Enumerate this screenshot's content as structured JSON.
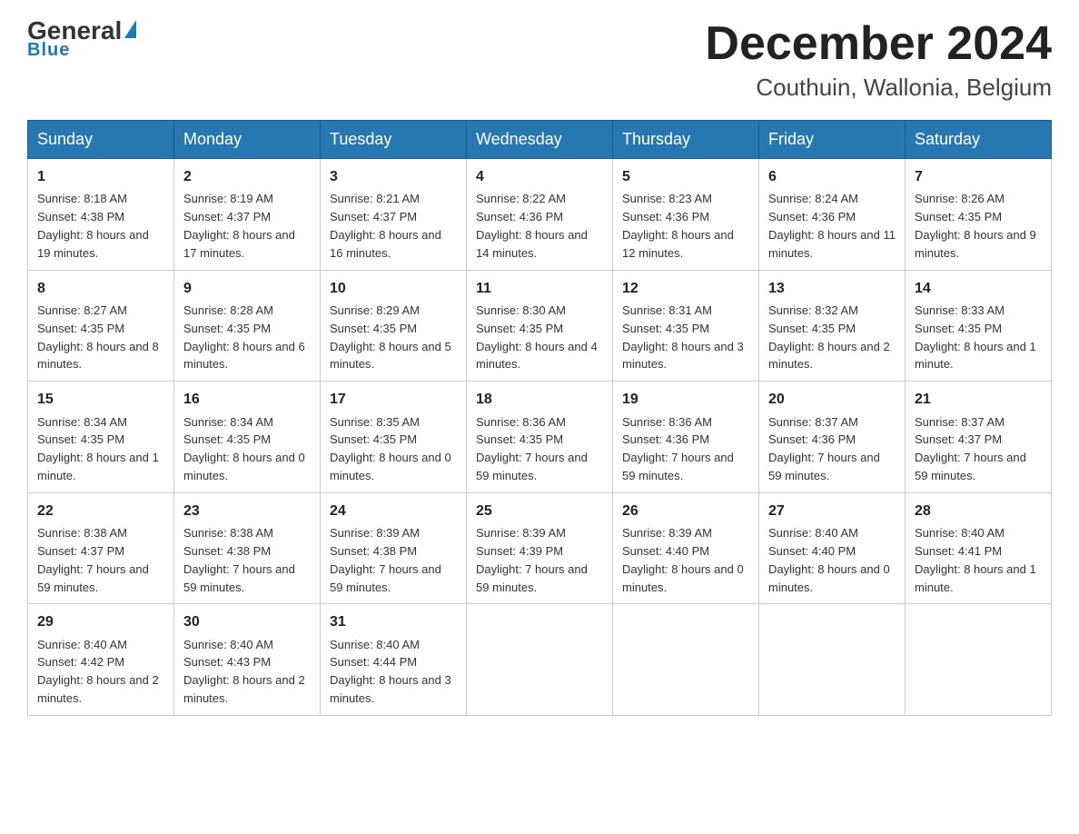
{
  "header": {
    "logo_general": "General",
    "logo_blue": "Blue",
    "month_title": "December 2024",
    "location": "Couthuin, Wallonia, Belgium"
  },
  "weekdays": [
    "Sunday",
    "Monday",
    "Tuesday",
    "Wednesday",
    "Thursday",
    "Friday",
    "Saturday"
  ],
  "weeks": [
    [
      {
        "day": "1",
        "sunrise": "8:18 AM",
        "sunset": "4:38 PM",
        "daylight": "8 hours and 19 minutes."
      },
      {
        "day": "2",
        "sunrise": "8:19 AM",
        "sunset": "4:37 PM",
        "daylight": "8 hours and 17 minutes."
      },
      {
        "day": "3",
        "sunrise": "8:21 AM",
        "sunset": "4:37 PM",
        "daylight": "8 hours and 16 minutes."
      },
      {
        "day": "4",
        "sunrise": "8:22 AM",
        "sunset": "4:36 PM",
        "daylight": "8 hours and 14 minutes."
      },
      {
        "day": "5",
        "sunrise": "8:23 AM",
        "sunset": "4:36 PM",
        "daylight": "8 hours and 12 minutes."
      },
      {
        "day": "6",
        "sunrise": "8:24 AM",
        "sunset": "4:36 PM",
        "daylight": "8 hours and 11 minutes."
      },
      {
        "day": "7",
        "sunrise": "8:26 AM",
        "sunset": "4:35 PM",
        "daylight": "8 hours and 9 minutes."
      }
    ],
    [
      {
        "day": "8",
        "sunrise": "8:27 AM",
        "sunset": "4:35 PM",
        "daylight": "8 hours and 8 minutes."
      },
      {
        "day": "9",
        "sunrise": "8:28 AM",
        "sunset": "4:35 PM",
        "daylight": "8 hours and 6 minutes."
      },
      {
        "day": "10",
        "sunrise": "8:29 AM",
        "sunset": "4:35 PM",
        "daylight": "8 hours and 5 minutes."
      },
      {
        "day": "11",
        "sunrise": "8:30 AM",
        "sunset": "4:35 PM",
        "daylight": "8 hours and 4 minutes."
      },
      {
        "day": "12",
        "sunrise": "8:31 AM",
        "sunset": "4:35 PM",
        "daylight": "8 hours and 3 minutes."
      },
      {
        "day": "13",
        "sunrise": "8:32 AM",
        "sunset": "4:35 PM",
        "daylight": "8 hours and 2 minutes."
      },
      {
        "day": "14",
        "sunrise": "8:33 AM",
        "sunset": "4:35 PM",
        "daylight": "8 hours and 1 minute."
      }
    ],
    [
      {
        "day": "15",
        "sunrise": "8:34 AM",
        "sunset": "4:35 PM",
        "daylight": "8 hours and 1 minute."
      },
      {
        "day": "16",
        "sunrise": "8:34 AM",
        "sunset": "4:35 PM",
        "daylight": "8 hours and 0 minutes."
      },
      {
        "day": "17",
        "sunrise": "8:35 AM",
        "sunset": "4:35 PM",
        "daylight": "8 hours and 0 minutes."
      },
      {
        "day": "18",
        "sunrise": "8:36 AM",
        "sunset": "4:35 PM",
        "daylight": "7 hours and 59 minutes."
      },
      {
        "day": "19",
        "sunrise": "8:36 AM",
        "sunset": "4:36 PM",
        "daylight": "7 hours and 59 minutes."
      },
      {
        "day": "20",
        "sunrise": "8:37 AM",
        "sunset": "4:36 PM",
        "daylight": "7 hours and 59 minutes."
      },
      {
        "day": "21",
        "sunrise": "8:37 AM",
        "sunset": "4:37 PM",
        "daylight": "7 hours and 59 minutes."
      }
    ],
    [
      {
        "day": "22",
        "sunrise": "8:38 AM",
        "sunset": "4:37 PM",
        "daylight": "7 hours and 59 minutes."
      },
      {
        "day": "23",
        "sunrise": "8:38 AM",
        "sunset": "4:38 PM",
        "daylight": "7 hours and 59 minutes."
      },
      {
        "day": "24",
        "sunrise": "8:39 AM",
        "sunset": "4:38 PM",
        "daylight": "7 hours and 59 minutes."
      },
      {
        "day": "25",
        "sunrise": "8:39 AM",
        "sunset": "4:39 PM",
        "daylight": "7 hours and 59 minutes."
      },
      {
        "day": "26",
        "sunrise": "8:39 AM",
        "sunset": "4:40 PM",
        "daylight": "8 hours and 0 minutes."
      },
      {
        "day": "27",
        "sunrise": "8:40 AM",
        "sunset": "4:40 PM",
        "daylight": "8 hours and 0 minutes."
      },
      {
        "day": "28",
        "sunrise": "8:40 AM",
        "sunset": "4:41 PM",
        "daylight": "8 hours and 1 minute."
      }
    ],
    [
      {
        "day": "29",
        "sunrise": "8:40 AM",
        "sunset": "4:42 PM",
        "daylight": "8 hours and 2 minutes."
      },
      {
        "day": "30",
        "sunrise": "8:40 AM",
        "sunset": "4:43 PM",
        "daylight": "8 hours and 2 minutes."
      },
      {
        "day": "31",
        "sunrise": "8:40 AM",
        "sunset": "4:44 PM",
        "daylight": "8 hours and 3 minutes."
      },
      null,
      null,
      null,
      null
    ]
  ]
}
